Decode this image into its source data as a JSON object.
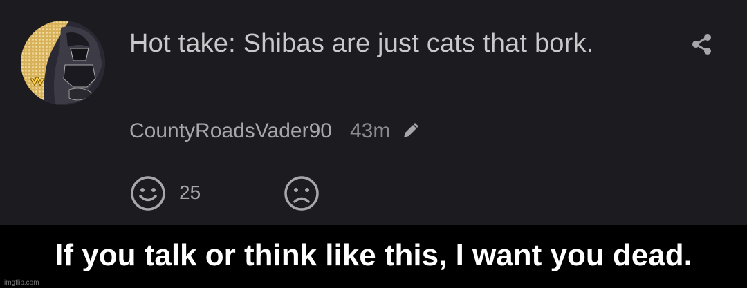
{
  "post": {
    "message": "Hot take: Shibas are just cats that bork.",
    "username": "CountyRoadsVader90",
    "time": "43m",
    "reactions": {
      "happy_count": "25"
    },
    "icons": {
      "share": "share-icon",
      "edit": "pencil-icon",
      "happy": "smiley-face-icon",
      "sad": "frown-face-icon"
    }
  },
  "caption": "If you talk or think like this, I want you dead.",
  "watermark": "imgflip.com",
  "colors": {
    "post_background": "#1c1c20",
    "caption_background": "#000000",
    "caption_text": "#ffffff",
    "message_text": "#c9c9cc",
    "muted_text": "#a7a7ab",
    "avatar_accent": "#c9a24a"
  }
}
